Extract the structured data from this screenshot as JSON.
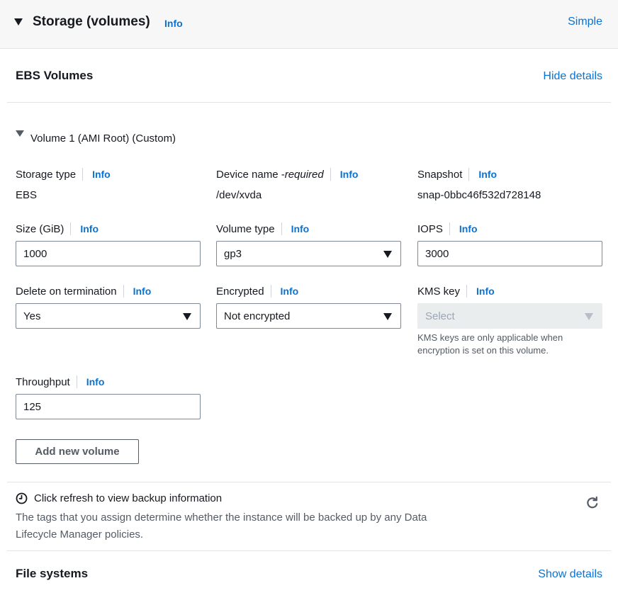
{
  "header": {
    "title": "Storage (volumes)",
    "info": "Info",
    "mode_link": "Simple"
  },
  "ebs": {
    "title": "EBS Volumes",
    "details_link": "Hide details"
  },
  "volume": {
    "title": "Volume 1 (AMI Root) (Custom)",
    "storage_type": {
      "label": "Storage type",
      "info": "Info",
      "value": "EBS"
    },
    "device_name": {
      "label": "Device name - ",
      "label_suffix": "required",
      "info": "Info",
      "value": "/dev/xvda"
    },
    "snapshot": {
      "label": "Snapshot",
      "info": "Info",
      "value": "snap-0bbc46f532d728148"
    },
    "size": {
      "label": "Size (GiB)",
      "info": "Info",
      "value": "1000"
    },
    "volume_type": {
      "label": "Volume type",
      "info": "Info",
      "value": "gp3"
    },
    "iops": {
      "label": "IOPS",
      "info": "Info",
      "value": "3000"
    },
    "delete_on_termination": {
      "label": "Delete on termination",
      "info": "Info",
      "value": "Yes"
    },
    "encrypted": {
      "label": "Encrypted",
      "info": "Info",
      "value": "Not encrypted"
    },
    "kms_key": {
      "label": "KMS key",
      "info": "Info",
      "placeholder": "Select",
      "help": "KMS keys are only applicable when encryption is set on this volume."
    },
    "throughput": {
      "label": "Throughput",
      "info": "Info",
      "value": "125"
    }
  },
  "add_volume_label": "Add new volume",
  "backup": {
    "title": "Click refresh to view backup information",
    "description": "The tags that you assign determine whether the instance will be backed up by any Data Lifecycle Manager policies."
  },
  "file_systems": {
    "title": "File systems",
    "details_link": "Show details"
  },
  "colors": {
    "link": "#0972d3",
    "text": "#16191f",
    "muted": "#545b64",
    "header_bg": "#f7f7f7"
  }
}
